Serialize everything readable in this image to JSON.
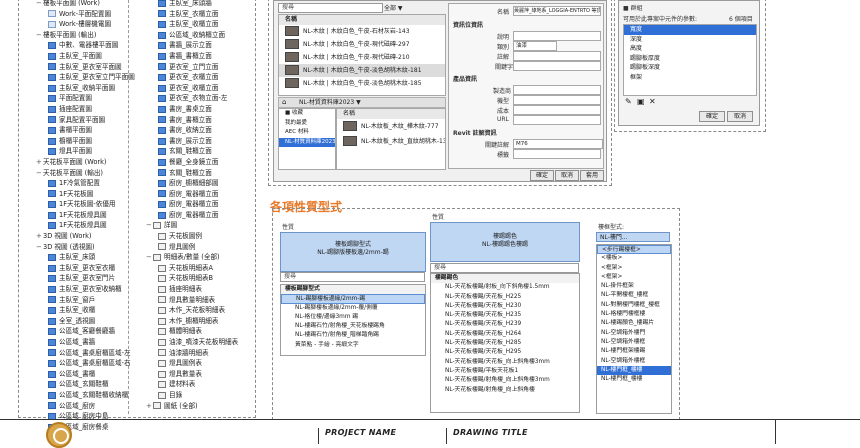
{
  "left_tree": {
    "col1": [
      {
        "label": "樓板平面圖 (Work)",
        "level": 0,
        "exp": "−"
      },
      {
        "label": "Work-平面配置圖",
        "level": 2,
        "icon": "plan"
      },
      {
        "label": "Work-樓層機電圖",
        "level": 2,
        "icon": "plan"
      },
      {
        "label": "樓板平面圖 (輸出)",
        "level": 0,
        "exp": "−"
      },
      {
        "label": "中數、電器樓平面圖",
        "level": 2,
        "icon": "blue"
      },
      {
        "label": "主臥室_平面圖",
        "level": 2,
        "icon": "blue"
      },
      {
        "label": "主臥室_更衣室平面圖",
        "level": 2,
        "icon": "blue"
      },
      {
        "label": "主臥室_更衣室立門平面圖",
        "level": 2,
        "icon": "blue"
      },
      {
        "label": "主臥室_收納平面圖",
        "level": 2,
        "icon": "blue"
      },
      {
        "label": "平面配置圖",
        "level": 2,
        "icon": "blue"
      },
      {
        "label": "插座配置圖",
        "level": 2,
        "icon": "blue"
      },
      {
        "label": "家具配置平面圖",
        "level": 2,
        "icon": "blue"
      },
      {
        "label": "書櫃平面圖",
        "level": 2,
        "icon": "blue"
      },
      {
        "label": "櫥櫃平面圖",
        "level": 2,
        "icon": "blue"
      },
      {
        "label": "燈具平面圖",
        "level": 2,
        "icon": "blue"
      },
      {
        "label": "天花板平面圖 (Work)",
        "level": 0,
        "exp": "+"
      },
      {
        "label": "天花板平面圖 (輸出)",
        "level": 0,
        "exp": "−"
      },
      {
        "label": "1F冷氣管配置",
        "level": 2,
        "icon": "blue"
      },
      {
        "label": "1F天花板圖",
        "level": 2,
        "icon": "blue"
      },
      {
        "label": "1F天花板圖-依優用",
        "level": 2,
        "icon": "blue"
      },
      {
        "label": "1F天花板燈具圖",
        "level": 2,
        "icon": "blue"
      },
      {
        "label": "1F天花板燈具圖",
        "level": 2,
        "icon": "blue"
      },
      {
        "label": "3D 視圖 (Work)",
        "level": 0,
        "exp": "+"
      },
      {
        "label": "3D 視圖 (透視圖)",
        "level": 0,
        "exp": "−"
      },
      {
        "label": "主臥室_床頭",
        "level": 2,
        "icon": "blue"
      },
      {
        "label": "主臥室_更衣室衣櫃",
        "level": 2,
        "icon": "blue"
      },
      {
        "label": "主臥室_更衣室門片",
        "level": 2,
        "icon": "blue"
      },
      {
        "label": "主臥室_更衣室收納櫃",
        "level": 2,
        "icon": "blue"
      },
      {
        "label": "主臥室_窗戶",
        "level": 2,
        "icon": "blue"
      },
      {
        "label": "主臥室_收櫃",
        "level": 2,
        "icon": "blue"
      },
      {
        "label": "全室_透視圖",
        "level": 2,
        "icon": "blue"
      },
      {
        "label": "公區域_客廳餐廳牆",
        "level": 2,
        "icon": "blue"
      },
      {
        "label": "公區域_書牆",
        "level": 2,
        "icon": "blue"
      },
      {
        "label": "公區域_書桌廚櫃區域-左",
        "level": 2,
        "icon": "blue"
      },
      {
        "label": "公區域_書桌廚櫃區域-右",
        "level": 2,
        "icon": "blue"
      },
      {
        "label": "公區域_書櫃",
        "level": 2,
        "icon": "blue"
      },
      {
        "label": "公區域_玄關鞋櫃",
        "level": 2,
        "icon": "blue"
      },
      {
        "label": "公區域_玄關鞋櫃收納櫃",
        "level": 2,
        "icon": "blue"
      },
      {
        "label": "公區域_廚房",
        "level": 2,
        "icon": "blue"
      },
      {
        "label": "公區域_廚房中島",
        "level": 2,
        "icon": "blue"
      },
      {
        "label": "公區域_廚房餐桌",
        "level": 2,
        "icon": "blue"
      }
    ],
    "col2": [
      {
        "label": "主臥室_床頭牆",
        "level": 2,
        "icon": "blue"
      },
      {
        "label": "主臥室_衣櫃立面",
        "level": 2,
        "icon": "blue"
      },
      {
        "label": "主臥室_收櫃立面",
        "level": 2,
        "icon": "blue"
      },
      {
        "label": "公區域_收納櫃立面",
        "level": 2,
        "icon": "blue"
      },
      {
        "label": "書牆_展示立面",
        "level": 2,
        "icon": "blue"
      },
      {
        "label": "書牆_書櫃立面",
        "level": 2,
        "icon": "blue"
      },
      {
        "label": "更衣室_立門立面",
        "level": 2,
        "icon": "blue"
      },
      {
        "label": "更衣室_衣櫃立面",
        "level": 2,
        "icon": "blue"
      },
      {
        "label": "更衣室_收櫃立面",
        "level": 2,
        "icon": "blue"
      },
      {
        "label": "更衣室_衣物立面-左",
        "level": 2,
        "icon": "blue"
      },
      {
        "label": "書房_書桌立面",
        "level": 2,
        "icon": "blue"
      },
      {
        "label": "書房_書櫃立面",
        "level": 2,
        "icon": "blue"
      },
      {
        "label": "書房_收納立面",
        "level": 2,
        "icon": "blue"
      },
      {
        "label": "書房_展示立面",
        "level": 2,
        "icon": "blue"
      },
      {
        "label": "玄關_鞋櫃立面",
        "level": 2,
        "icon": "blue"
      },
      {
        "label": "餐廳_全身鏡立面",
        "level": 2,
        "icon": "blue"
      },
      {
        "label": "玄關_鞋櫃立面",
        "level": 2,
        "icon": "blue"
      },
      {
        "label": "廚房_櫥櫃細部圖",
        "level": 2,
        "icon": "blue"
      },
      {
        "label": "廚房_電器櫃立面",
        "level": 2,
        "icon": "blue"
      },
      {
        "label": "廚房_電器櫃立面",
        "level": 2,
        "icon": "blue"
      },
      {
        "label": "廚房_電器櫃立面",
        "level": 2,
        "icon": "blue"
      },
      {
        "label": "詳圖",
        "level": 0,
        "exp": "−",
        "icon": "sheet"
      },
      {
        "label": "天花板圖例",
        "level": 2,
        "icon": "sheet"
      },
      {
        "label": "燈具圖例",
        "level": 2,
        "icon": "sheet"
      },
      {
        "label": "明細表/數量 (全部)",
        "level": 0,
        "exp": "−",
        "icon": "sheet"
      },
      {
        "label": "天花板明細表A",
        "level": 2,
        "icon": "sheet"
      },
      {
        "label": "天花板明細表B",
        "level": 2,
        "icon": "sheet"
      },
      {
        "label": "插座明細表",
        "level": 2,
        "icon": "sheet"
      },
      {
        "label": "燈具數量明細表",
        "level": 2,
        "icon": "sheet"
      },
      {
        "label": "木作_天花板明細表",
        "level": 2,
        "icon": "sheet"
      },
      {
        "label": "木作_櫥櫃明細表",
        "level": 2,
        "icon": "sheet"
      },
      {
        "label": "櫃體明細表",
        "level": 2,
        "icon": "sheet"
      },
      {
        "label": "油漆_噴漆天花板明細表",
        "level": 2,
        "icon": "sheet"
      },
      {
        "label": "油漆牆明細表",
        "level": 2,
        "icon": "sheet"
      },
      {
        "label": "燈具圖例表",
        "level": 2,
        "icon": "sheet"
      },
      {
        "label": "燈具數量表",
        "level": 2,
        "icon": "sheet"
      },
      {
        "label": "建材料表",
        "level": 2,
        "icon": "sheet"
      },
      {
        "label": "目錄",
        "level": 2,
        "icon": "sheet"
      },
      {
        "label": "圖紙 (全部)",
        "level": 0,
        "exp": "+",
        "icon": "sheet"
      }
    ]
  },
  "material_browser": {
    "search_hint": "搜尋",
    "header_col": "名稱",
    "project_materials": [
      {
        "label": "NL-木紋 | 木紋白色_牛皮-石材灰岩-143"
      },
      {
        "label": "NL-木紋 | 木紋白色_牛皮-現代磁磚-297"
      },
      {
        "label": "NL-木紋 | 木紋白色_牛皮-現代磁磚-210"
      },
      {
        "label": "NL-木紋 | 木紋白色_牛皮-淡色胡桃木紋-181"
      },
      {
        "label": "NL-木紋 | 木紋白色_牛皮-淡色胡桃木紋-185"
      }
    ],
    "filter_label": "全部 ▼",
    "lib_crumb": "NL-材質資料庫2023 ▼",
    "lib_tree": [
      "■ 收藏",
      "我的最愛",
      "AEC 材料",
      "NL-材質資料庫2023"
    ],
    "lib_items": [
      {
        "label": "NL-木紋板_木紋_樺木紋-777"
      },
      {
        "label": "NL-木紋板_木紋_直紋胡桃木-138"
      }
    ],
    "lib_header": "名稱",
    "props": {
      "name_label": "名稱",
      "name_value": "黃麗萍_綠地系_LOGGIA-ENTRTO 等頂色",
      "sec_info": "資訊位資訊",
      "desc_label": "說明",
      "class_label": "類別",
      "class_value": "油漆",
      "comment_label": "註解",
      "keyword_label": "關鍵字",
      "sec_product": "產品資訊",
      "maker_label": "製造商",
      "model_label": "機型",
      "cost_label": "成本",
      "url_label": "URL",
      "sec_revit": "Revit 註解資訊",
      "keynote_label": "關鍵註解",
      "keynote_value": "M76",
      "mark_label": "標籤",
      "ok": "確定",
      "cancel": "取消",
      "apply": "套用"
    }
  },
  "params_dialog": {
    "title": "■ 群組",
    "sub_label": "可用於此專案中元件的參數:",
    "count_label": "6 個項目",
    "items": [
      "寬度",
      "深度",
      "高度",
      "踢腳板厚度",
      "踢腳板深度",
      "框架"
    ],
    "ok": "確定",
    "cancel": "取消"
  },
  "section_heading": "各項性質型式",
  "type_panels": [
    {
      "label": "性質",
      "type_line1": "樓板踢腳型式",
      "type_line2": "NL-踢腳版樓板邊/2mm-踢",
      "search": "搜尋",
      "group": "樓板踢腳型式",
      "items": [
        "NL-踢腳樓板邊緣/2mm-踢",
        "NL-踢腳樓板邊緣/2mm-覆/側覆",
        "NL-格位樓/邊緣3mm 踢",
        "NL-樓踢石竹/射角樓_天花板樓踢角",
        "NL-樓踢石竹/射角樓_階梯踏角踢",
        "黃菜點 - 手繪 - 亮緞文字"
      ],
      "sel_index": 0
    },
    {
      "label": "性質",
      "type_line1": "樓踢踢色",
      "type_line2": "NL-樓踢踢色樓踢",
      "search": "搜尋",
      "group": "樓踢踢色",
      "items": [
        "NL-天花板樓踢/射板_向下斜角樓1.5mm",
        "NL-天花板樓踢/天花板_H225",
        "NL-天花板樓踢/天花板_H230",
        "NL-天花板樓踢/天花板_H235",
        "NL-天花板樓踢/天花板_H239",
        "NL-天花板樓踢/天花板_H264",
        "NL-天花板樓踢/天花板_H285",
        "NL-天花板樓踢/天花板_H295",
        "NL-天花板樓踢/天花板_向上斜角樓3mm",
        "NL-天花板樓踢/平板天花板1",
        "NL-天花板樓踢/射角樓_向上斜角樓3mm",
        "NL-天花板樓踢/射角樓_向上斜角樓"
      ],
      "sel_index": -1
    },
    {
      "label": "性質",
      "type_line1": "",
      "type_line2": "NL-樓門...",
      "search": "搜尋",
      "group": "",
      "items": [
        "<步行踢樓框>",
        "<樓板>",
        "<框架>",
        "<框架>",
        "NL-掛件框架",
        "NL-平開樓框_樓框",
        "NL-對開樓門樓框_樓框",
        "NL-格樓門樓框樓",
        "NL-樓踢顏色_樓踢片",
        "NL-空調箱外樓門",
        "NL-空調箱外樓框",
        "NL-樓門框架樓踢",
        "NL-空調箱外樓框",
        "NL-樓門框_樓樓",
        "NL-樓門框_樓樓"
      ],
      "sel_index": 13
    }
  ],
  "dropdown_label": "樓框型式:",
  "title_block": {
    "project_label": "PROJECT NAME",
    "drawing_label": "DRAWING TITLE"
  },
  "colors": {
    "accent": "#e87a2a",
    "selection": "#2f6fd6",
    "type_header": "#bfd7f2"
  }
}
